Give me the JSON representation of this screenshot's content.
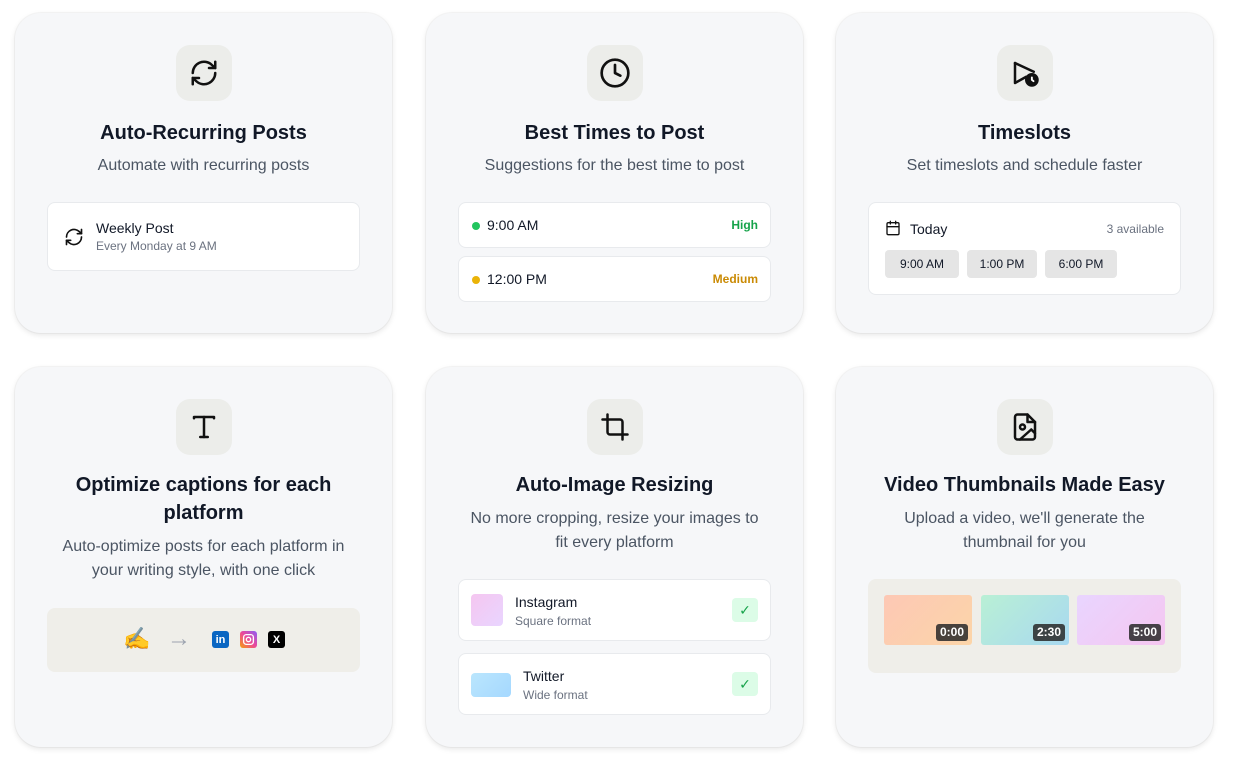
{
  "cards": {
    "recurring": {
      "title": "Auto-Recurring Posts",
      "desc": "Automate with recurring posts",
      "item_title": "Weekly Post",
      "item_sub": "Every Monday at 9 AM"
    },
    "best_times": {
      "title": "Best Times to Post",
      "desc": "Suggestions for the best time to post",
      "rows": [
        {
          "time": "9:00 AM",
          "level": "High",
          "color": "#22c55e",
          "level_color": "#16a34a"
        },
        {
          "time": "12:00 PM",
          "level": "Medium",
          "color": "#eab308",
          "level_color": "#ca8a04"
        }
      ]
    },
    "timeslots": {
      "title": "Timeslots",
      "desc": "Set timeslots and schedule faster",
      "day": "Today",
      "available": "3 available",
      "slots": [
        "9:00 AM",
        "1:00 PM",
        "6:00 PM"
      ]
    },
    "captions": {
      "title_line1": "Optimize captions for each",
      "title_line2": "platform",
      "desc_line1": "Auto-optimize posts for each platform in",
      "desc_line2": "your writing style, with one click",
      "emoji": "✍️",
      "arrow": "→",
      "platforms": [
        "in",
        "instagram",
        "X"
      ]
    },
    "resizing": {
      "title": "Auto-Image Resizing",
      "desc_line1": "No more cropping, resize your images to",
      "desc_line2": "fit every platform",
      "formats": [
        {
          "name": "Instagram",
          "sub": "Square format",
          "check": "✓"
        },
        {
          "name": "Twitter",
          "sub": "Wide format",
          "check": "✓"
        }
      ]
    },
    "thumbnails": {
      "title": "Video Thumbnails Made Easy",
      "desc_line1": "Upload a video, we'll generate the",
      "desc_line2": "thumbnail for you",
      "durations": [
        "0:00",
        "2:30",
        "5:00"
      ]
    }
  },
  "colors": {
    "card_bg": "#f6f7f9",
    "icon_bg": "#ecedea",
    "linkedin": "#0a66c2",
    "x": "#000000"
  }
}
